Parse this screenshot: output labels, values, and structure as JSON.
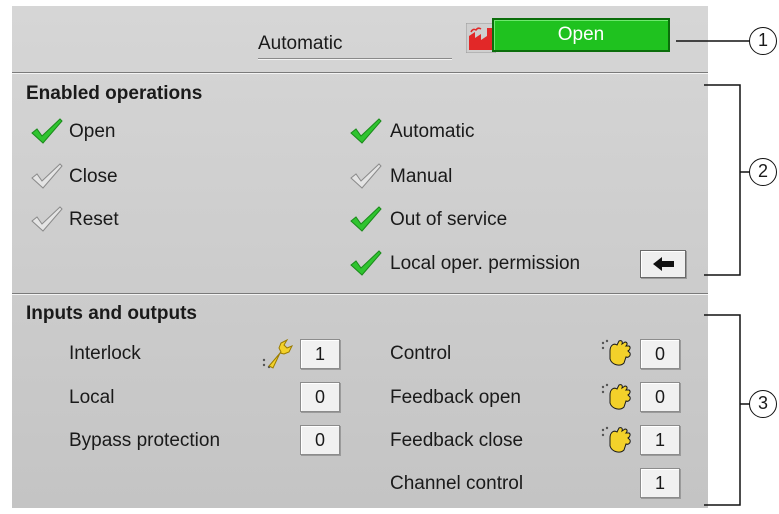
{
  "header": {
    "mode_label": "Automatic",
    "state_label": "Open",
    "state_color": "#1fc21f"
  },
  "enabled_operations": {
    "title": "Enabled operations",
    "items": [
      {
        "label": "Open",
        "enabled": true
      },
      {
        "label": "Close",
        "enabled": false
      },
      {
        "label": "Reset",
        "enabled": false
      },
      {
        "label": "Automatic",
        "enabled": true
      },
      {
        "label": "Manual",
        "enabled": false
      },
      {
        "label": "Out of service",
        "enabled": true
      },
      {
        "label": "Local oper. permission",
        "enabled": true
      }
    ]
  },
  "inputs_outputs": {
    "title": "Inputs and outputs",
    "left": [
      {
        "label": "Interlock",
        "value": "1",
        "icon": "wrench-icon"
      },
      {
        "label": "Local",
        "value": "0"
      },
      {
        "label": "Bypass protection",
        "value": "0"
      }
    ],
    "right": [
      {
        "label": "Control",
        "value": "0",
        "icon": "hand-icon"
      },
      {
        "label": "Feedback open",
        "value": "0",
        "icon": "hand-icon"
      },
      {
        "label": "Feedback close",
        "value": "1",
        "icon": "hand-icon"
      },
      {
        "label": "Channel control",
        "value": "1"
      }
    ]
  },
  "callouts": [
    "1",
    "2",
    "3"
  ],
  "colors": {
    "check_enabled": "#2fc42f",
    "check_disabled": "#9a9a9a",
    "panel_bg": "#cdcdcd",
    "value_box": "#f1f1f1"
  }
}
